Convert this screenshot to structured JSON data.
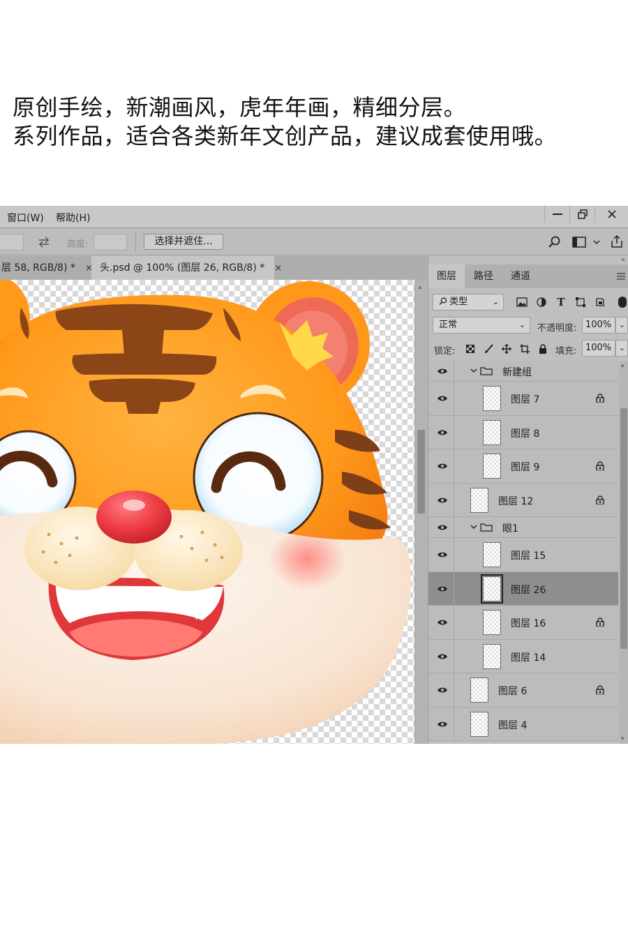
{
  "caption": {
    "line1": "原创手绘，新潮画风，虎年年画，精细分层。",
    "line2": "系列作品，适合各类新年文创产品，建议成套使用哦。"
  },
  "menu": {
    "window": "窗口(W)",
    "help": "帮助(H)"
  },
  "options": {
    "height_label": "高度:",
    "select_mask_button": "选择并遮住..."
  },
  "doc_tabs": [
    {
      "label": "层 58, RGB/8) *",
      "close": "×"
    },
    {
      "label": "头.psd @ 100% (图层 26, RGB/8) *",
      "close": "×"
    }
  ],
  "panel": {
    "tabs": [
      "图层",
      "路径",
      "通道"
    ],
    "filter_kind": "类型",
    "blend_mode": "正常",
    "opacity_label": "不透明度:",
    "opacity_value": "100%",
    "lock_label": "锁定:",
    "fill_label": "填充:",
    "fill_value": "100%",
    "layers": [
      {
        "name": "新建组",
        "kind": "group",
        "expanded": true,
        "locked": false,
        "selected": false
      },
      {
        "name": "图层 7",
        "kind": "layer",
        "locked": true,
        "selected": false
      },
      {
        "name": "图层 8",
        "kind": "layer",
        "locked": false,
        "selected": false
      },
      {
        "name": "图层 9",
        "kind": "layer",
        "locked": true,
        "selected": false
      },
      {
        "name": "图层 12",
        "kind": "layer",
        "locked": true,
        "selected": false
      },
      {
        "name": "眼1",
        "kind": "group",
        "expanded": true,
        "locked": false,
        "selected": false
      },
      {
        "name": "图层 15",
        "kind": "layer",
        "locked": false,
        "selected": false
      },
      {
        "name": "图层 26",
        "kind": "layer",
        "locked": false,
        "selected": true
      },
      {
        "name": "图层 16",
        "kind": "layer",
        "locked": true,
        "selected": false
      },
      {
        "name": "图层 14",
        "kind": "layer",
        "locked": false,
        "selected": false
      },
      {
        "name": "图层 6",
        "kind": "layer",
        "locked": true,
        "selected": false
      },
      {
        "name": "图层 4",
        "kind": "layer",
        "locked": false,
        "selected": false
      }
    ]
  },
  "icons": {
    "eye": "eye-icon",
    "lock": "lock-icon",
    "folder": "folder-icon",
    "search": "search-icon",
    "share": "share-icon",
    "swap": "swap-arrows-icon"
  },
  "colors": {
    "selected_layer": "#8e8e8e",
    "tiger_orange": "#ff9a1f",
    "nose_red": "#e8343c"
  }
}
